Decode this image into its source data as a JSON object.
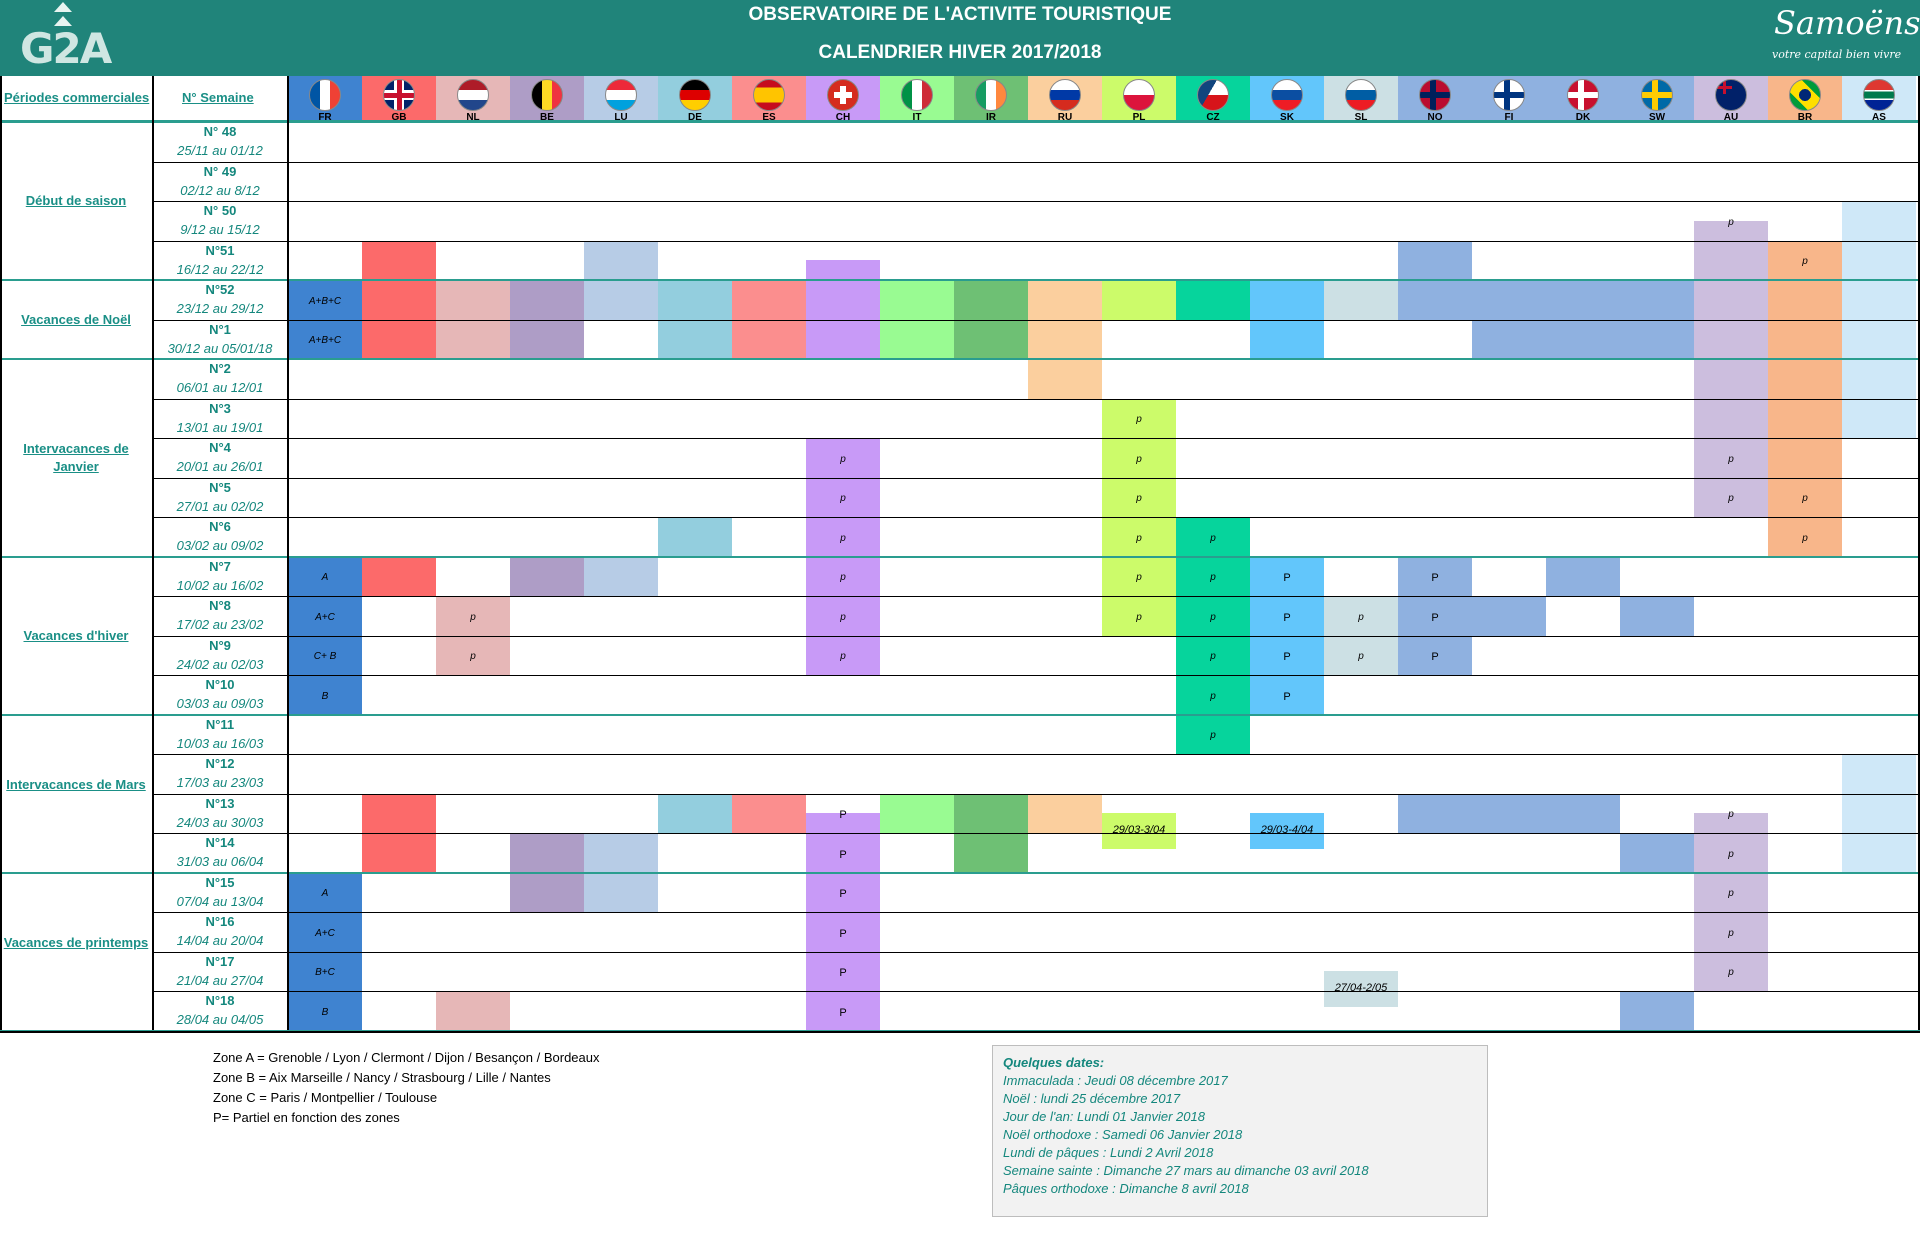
{
  "header": {
    "title": "OBSERVATOIRE DE L'ACTIVITE TOURISTIQUE",
    "subtitle": "CALENDRIER HIVER 2017/2018",
    "logo_left": "G2A",
    "logo_right": "Samoëns",
    "logo_right_tagline": "votre capital bien vivre"
  },
  "columns": {
    "periods_label": "Périodes commerciales",
    "week_label": "N° Semaine"
  },
  "countries": [
    {
      "code": "FR",
      "color": "#3f83d0"
    },
    {
      "code": "GB",
      "color": "#fc6a6a"
    },
    {
      "code": "NL",
      "color": "#e6b7b7"
    },
    {
      "code": "BE",
      "color": "#ae9dc6"
    },
    {
      "code": "LU",
      "color": "#b7cce6"
    },
    {
      "code": "DE",
      "color": "#93cede"
    },
    {
      "code": "ES",
      "color": "#fb8e8e"
    },
    {
      "code": "CH",
      "color": "#c89af7"
    },
    {
      "code": "IT",
      "color": "#99fb92"
    },
    {
      "code": "IR",
      "color": "#6ec074"
    },
    {
      "code": "RU",
      "color": "#fbcf9e"
    },
    {
      "code": "PL",
      "color": "#ccfb6a"
    },
    {
      "code": "CZ",
      "color": "#06d49c"
    },
    {
      "code": "SK",
      "color": "#62c6fb"
    },
    {
      "code": "SL",
      "color": "#cce0e4"
    },
    {
      "code": "NO",
      "color": "#8fb1e0"
    },
    {
      "code": "FI",
      "color": "#8fb1e0"
    },
    {
      "code": "DK",
      "color": "#8fb1e0"
    },
    {
      "code": "SW",
      "color": "#8fb1e0"
    },
    {
      "code": "AU",
      "color": "#ccbede"
    },
    {
      "code": "BR",
      "color": "#f8b68a"
    },
    {
      "code": "AS",
      "color": "#cfe8f8"
    }
  ],
  "periods": [
    {
      "name": "Début de saison"
    },
    {
      "name": "Vacances de Noël"
    },
    {
      "name": "Intervacances de Janvier"
    },
    {
      "name": "Vacances d'hiver"
    },
    {
      "name": "Intervacances de Mars"
    },
    {
      "name": "Vacances de printemps"
    }
  ],
  "weeks": [
    {
      "num": "N° 48",
      "dates": "25/11 au 01/12",
      "cells": {}
    },
    {
      "num": "N° 49",
      "dates": "02/12 au 8/12",
      "cells": {}
    },
    {
      "num": "N° 50",
      "dates": "9/12 au 15/12",
      "cells": {
        "AU": "p",
        "AS": ""
      }
    },
    {
      "num": "N°51",
      "dates": "16/12 au 22/12",
      "cells": {
        "GB": "",
        "LU": "",
        "CH": "",
        "NO": "",
        "AU": "",
        "BR": "p",
        "AS": ""
      }
    },
    {
      "num": "N°52",
      "dates": "23/12 au 29/12",
      "cells": {
        "FR": "A+B+C",
        "GB": "",
        "NL": "",
        "BE": "",
        "LU": "",
        "DE": "",
        "ES": "",
        "CH": "",
        "IT": "",
        "IR": "",
        "RU": "",
        "PL": "",
        "CZ": "",
        "SK": "",
        "SL": "",
        "NO": "",
        "FI": "",
        "DK": "",
        "SW": "",
        "AU": "",
        "BR": "",
        "AS": ""
      }
    },
    {
      "num": "N°1",
      "dates": "30/12 au 05/01/18",
      "cells": {
        "FR": "A+B+C",
        "GB": "",
        "NL": "",
        "BE": "",
        "DE": "",
        "ES": "",
        "CH": "",
        "IT": "",
        "IR": "",
        "RU": "",
        "SK": "",
        "FI": "",
        "DK": "",
        "SW": "",
        "AU": "",
        "BR": "",
        "AS": ""
      }
    },
    {
      "num": "N°2",
      "dates": "06/01 au 12/01",
      "cells": {
        "RU": "",
        "AU": "",
        "BR": "",
        "AS": ""
      }
    },
    {
      "num": "N°3",
      "dates": "13/01 au 19/01",
      "cells": {
        "PL": "p",
        "AU": "",
        "BR": "",
        "AS": ""
      }
    },
    {
      "num": "N°4",
      "dates": "20/01 au 26/01",
      "cells": {
        "CH": "p",
        "PL": "p",
        "AU": "p",
        "BR": ""
      }
    },
    {
      "num": "N°5",
      "dates": "27/01 au 02/02",
      "cells": {
        "CH": "p",
        "PL": "p",
        "AU": "p",
        "BR": "p"
      }
    },
    {
      "num": "N°6",
      "dates": "03/02 au 09/02",
      "cells": {
        "DE": "",
        "CH": "p",
        "PL": "p",
        "CZ": "p",
        "BR": "p"
      }
    },
    {
      "num": "N°7",
      "dates": "10/02 au 16/02",
      "cells": {
        "FR": "A",
        "GB": "",
        "BE": "",
        "LU": "",
        "CH": "p",
        "PL": "p",
        "CZ": "p",
        "SK": "P",
        "NO": "P",
        "DK": ""
      }
    },
    {
      "num": "N°8",
      "dates": "17/02 au 23/02",
      "cells": {
        "FR": "A+C",
        "NL": "p",
        "CH": "p",
        "PL": "p",
        "CZ": "p",
        "SK": "P",
        "SL": "p",
        "NO": "P",
        "FI": "",
        "SW": ""
      }
    },
    {
      "num": "N°9",
      "dates": "24/02 au 02/03",
      "cells": {
        "FR": "C+ B",
        "NL": "p",
        "CH": "p",
        "CZ": "p",
        "SK": "P",
        "SL": "p",
        "NO": "P"
      }
    },
    {
      "num": "N°10",
      "dates": "03/03 au 09/03",
      "cells": {
        "FR": "B",
        "CZ": "p",
        "SK": "P"
      }
    },
    {
      "num": "N°11",
      "dates": "10/03 au 16/03",
      "cells": {
        "CZ": "p"
      }
    },
    {
      "num": "N°12",
      "dates": "17/03 au 23/03",
      "cells": {
        "AS": ""
      }
    },
    {
      "num": "N°13",
      "dates": "24/03 au 30/03",
      "cells": {
        "GB": "",
        "DE": "",
        "ES": "",
        "CH": "P",
        "IT": "",
        "IR": "",
        "RU": "",
        "NO": "",
        "FI": "",
        "DK": "",
        "AU": "p",
        "AS": ""
      }
    },
    {
      "num": "N°14",
      "dates": "31/03 au 06/04",
      "cells": {
        "GB": "",
        "BE": "",
        "LU": "",
        "CH": "P",
        "IR": "",
        "SW": "",
        "AU": "p",
        "AS": ""
      }
    },
    {
      "num": "N°15",
      "dates": "07/04 au 13/04",
      "cells": {
        "FR": "A",
        "BE": "",
        "LU": "",
        "CH": "P",
        "AU": "p"
      }
    },
    {
      "num": "N°16",
      "dates": "14/04 au 20/04",
      "cells": {
        "FR": "A+C",
        "CH": "P",
        "AU": "p"
      }
    },
    {
      "num": "N°17",
      "dates": "21/04 au 27/04",
      "cells": {
        "FR": "B+C",
        "CH": "P",
        "AU": "p"
      }
    },
    {
      "num": "N°18",
      "dates": "28/04 au 04/05",
      "cells": {
        "FR": "B",
        "NL": "",
        "CH": "P",
        "SW": ""
      }
    }
  ],
  "special_labels": {
    "pl_easter": "29/03-3/04",
    "sk_easter": "29/03-4/04",
    "sl_spring": "27/04-2/05"
  },
  "legend": [
    "Zone A = Grenoble / Lyon / Clermont / Dijon / Besançon / Bordeaux",
    "Zone B = Aix Marseille / Nancy / Strasbourg / Lille / Nantes",
    "Zone C = Paris / Montpellier / Toulouse",
    "P= Partiel en fonction des zones"
  ],
  "dates_box": {
    "heading": "Quelques dates:",
    "items": [
      "Immaculada : Jeudi 08 décembre 2017",
      "Noël : lundi 25 décembre 2017",
      "Jour de l'an: Lundi 01 Janvier 2018",
      "Noël orthodoxe : Samedi 06 Janvier 2018",
      "Lundi de pâques : Lundi 2 Avril 2018",
      "Semaine sainte : Dimanche 27 mars au dimanche 03 avril 2018",
      "Pâques orthodoxe : Dimanche 8 avril 2018"
    ]
  }
}
